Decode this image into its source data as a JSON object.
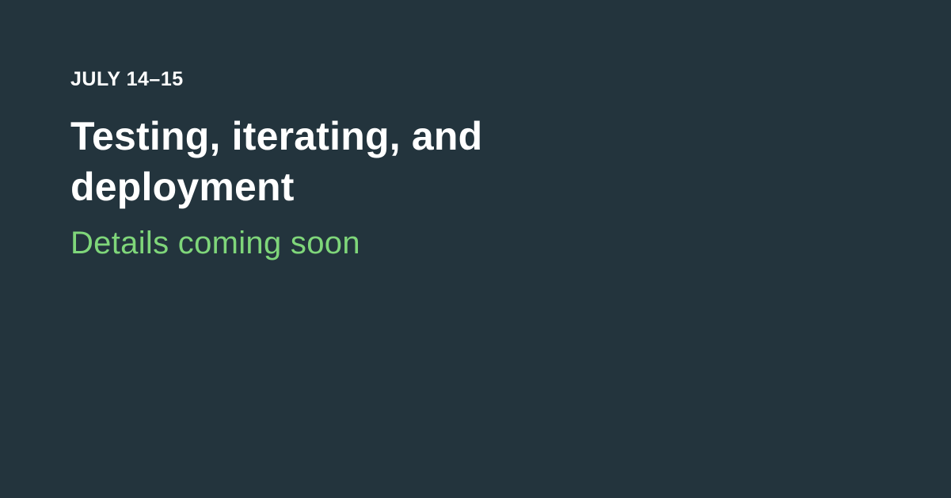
{
  "event": {
    "date": "JULY 14–15",
    "title_line1": "Testing, iterating, and",
    "title_line2": "deployment",
    "subtitle": "Details coming soon"
  },
  "colors": {
    "background": "#23343d",
    "text_primary": "#ffffff",
    "accent": "#7fd67a"
  }
}
